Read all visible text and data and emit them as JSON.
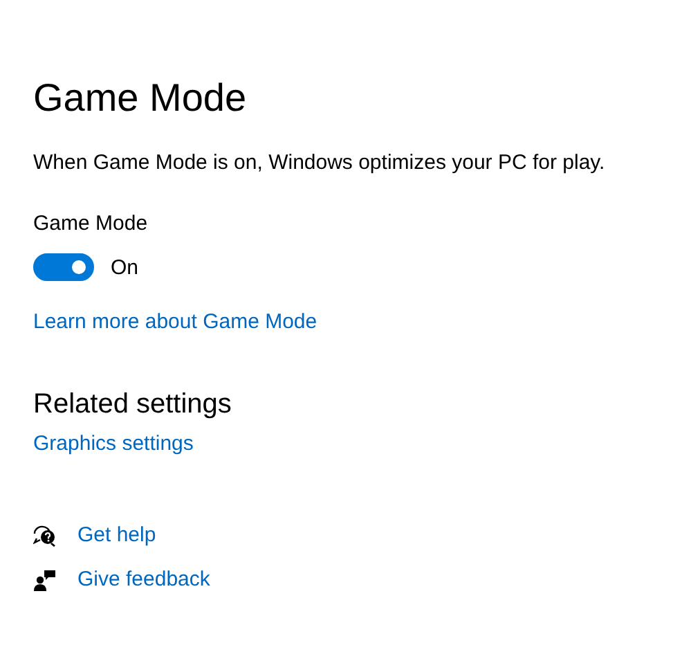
{
  "title": "Game Mode",
  "description": "When Game Mode is on, Windows optimizes your PC for play.",
  "setting": {
    "label": "Game Mode",
    "on": true,
    "state_text": "On"
  },
  "learn_more": "Learn more about Game Mode",
  "related": {
    "heading": "Related settings",
    "links": [
      "Graphics settings"
    ]
  },
  "help_links": [
    {
      "kind": "help",
      "label": "Get help"
    },
    {
      "kind": "feedback",
      "label": "Give feedback"
    }
  ]
}
